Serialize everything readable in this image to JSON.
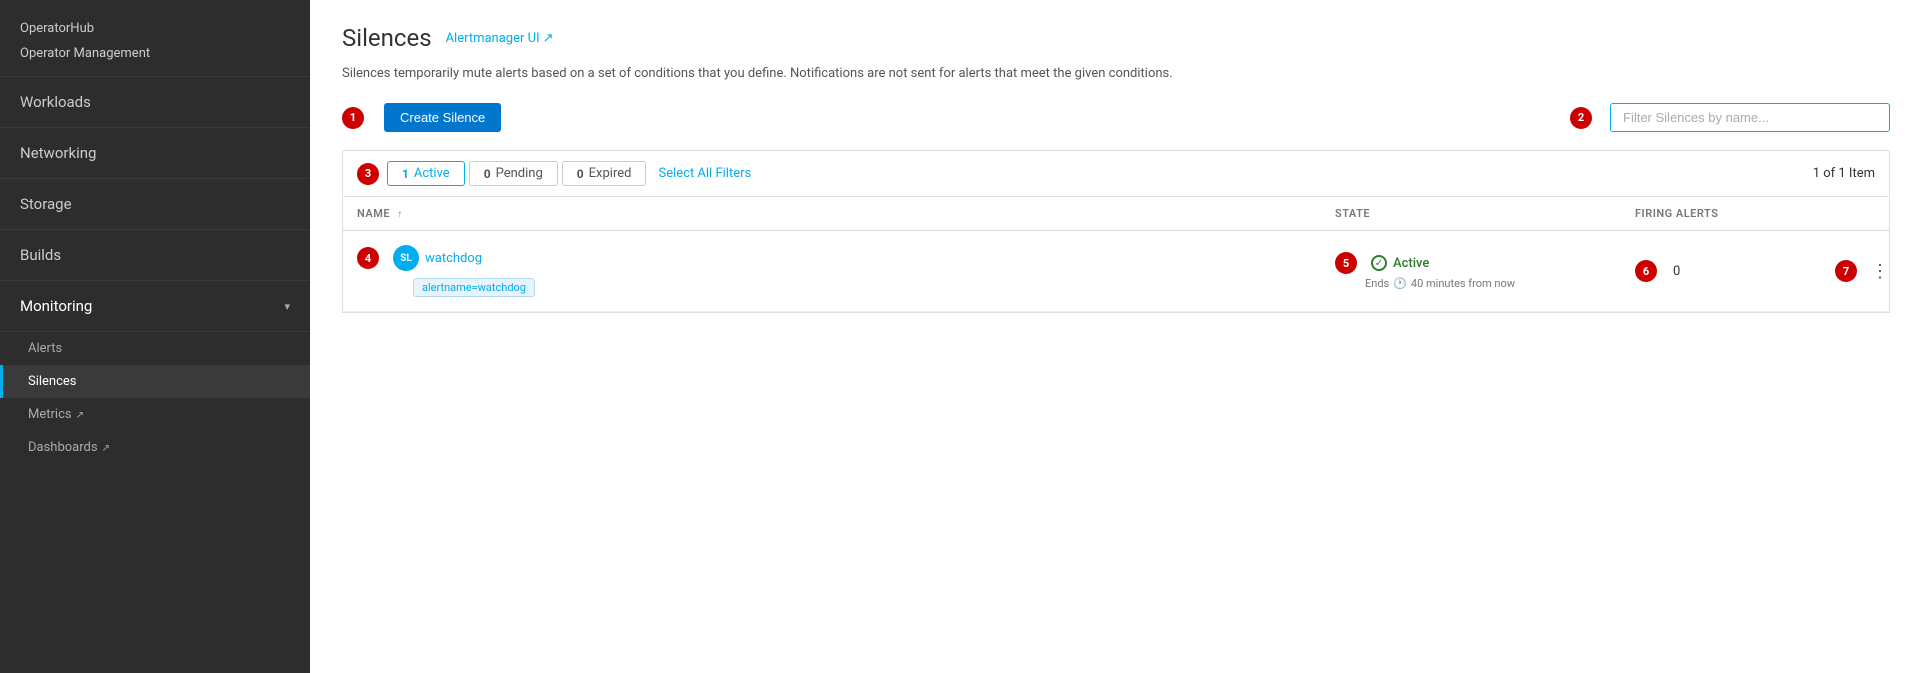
{
  "sidebar": {
    "top_items": [
      {
        "label": "OperatorHub"
      },
      {
        "label": "Operator Management"
      }
    ],
    "nav_items": [
      {
        "label": "Workloads",
        "has_chevron": false
      },
      {
        "label": "Networking",
        "has_chevron": false
      },
      {
        "label": "Storage",
        "has_chevron": false
      },
      {
        "label": "Builds",
        "has_chevron": false
      }
    ],
    "monitoring": {
      "label": "Monitoring",
      "sub_items": [
        {
          "label": "Alerts",
          "active": false
        },
        {
          "label": "Silences",
          "active": true
        },
        {
          "label": "Metrics",
          "external": true
        },
        {
          "label": "Dashboards",
          "external": true
        }
      ]
    }
  },
  "page": {
    "title": "Silences",
    "alertmanager_link": "Alertmanager UI",
    "description": "Silences temporarily mute alerts based on a set of conditions that you define. Notifications are not sent for alerts that meet the given conditions.",
    "create_button": "Create Silence",
    "filter_placeholder": "Filter Silences by name...",
    "item_count": "1 of 1 Item"
  },
  "filters": {
    "active": {
      "count": 1,
      "label": "Active",
      "selected": true
    },
    "pending": {
      "count": 0,
      "label": "Pending"
    },
    "expired": {
      "count": 0,
      "label": "Expired"
    },
    "select_all": "Select All Filters"
  },
  "table": {
    "columns": {
      "name": "NAME",
      "state": "STATE",
      "firing_alerts": "FIRING ALERTS"
    },
    "rows": [
      {
        "avatar": "SL",
        "name": "watchdog",
        "tag": "alertname=watchdog",
        "state": "Active",
        "ends_label": "Ends",
        "ends_time": "40 minutes from now",
        "firing_alerts": "0"
      }
    ]
  },
  "step_badges": {
    "s1": "1",
    "s2": "2",
    "s3": "3",
    "s4": "4",
    "s5": "5",
    "s6": "6",
    "s7": "7"
  }
}
